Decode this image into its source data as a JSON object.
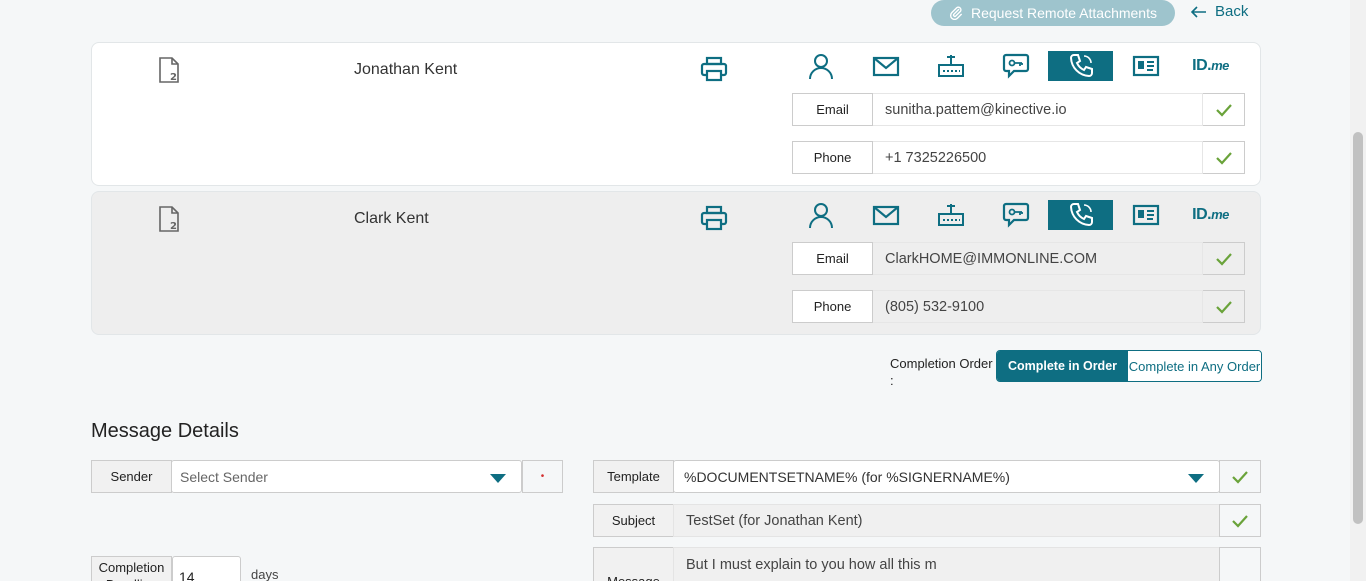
{
  "header": {
    "request_remote_label": "Request Remote Attachments",
    "back_label": "Back"
  },
  "signers": [
    {
      "name": "Jonathan Kent",
      "email_label": "Email",
      "email": "sunitha.pattem@kinective.io",
      "phone_label": "Phone",
      "phone": "+1 7325226500"
    },
    {
      "name": "Clark Kent",
      "email_label": "Email",
      "email": "ClarkHOME@IMMONLINE.COM",
      "phone_label": "Phone",
      "phone": "(805) 532-9100"
    }
  ],
  "auth_methods": [
    "user-icon",
    "mail-icon",
    "router-icon",
    "chat-key-icon",
    "phone-icon",
    "id-card-icon",
    "idme-logo"
  ],
  "idme": {
    "id": "ID.",
    "me": "me"
  },
  "completion": {
    "label": "Completion Order",
    "colon": ":",
    "in_order": "Complete in Order",
    "any_order": "Complete in Any Order"
  },
  "message_details": {
    "title": "Message Details",
    "sender_label": "Sender",
    "sender_placeholder": "Select Sender",
    "required_mark": "•",
    "template_label": "Template",
    "template_value": "%DOCUMENTSETNAME% (for %SIGNERNAME%)",
    "subject_label": "Subject",
    "subject_value": "TestSet (for Jonathan Kent)",
    "deadline_label": "Completion Deadline",
    "deadline_value": "14",
    "deadline_unit": "days",
    "message_label": "Message",
    "message_value": "But I must explain to you how all this m"
  },
  "colors": {
    "accent": "#0e6e82",
    "check": "#6aa33a",
    "remote_button": "#9ec4cd"
  }
}
